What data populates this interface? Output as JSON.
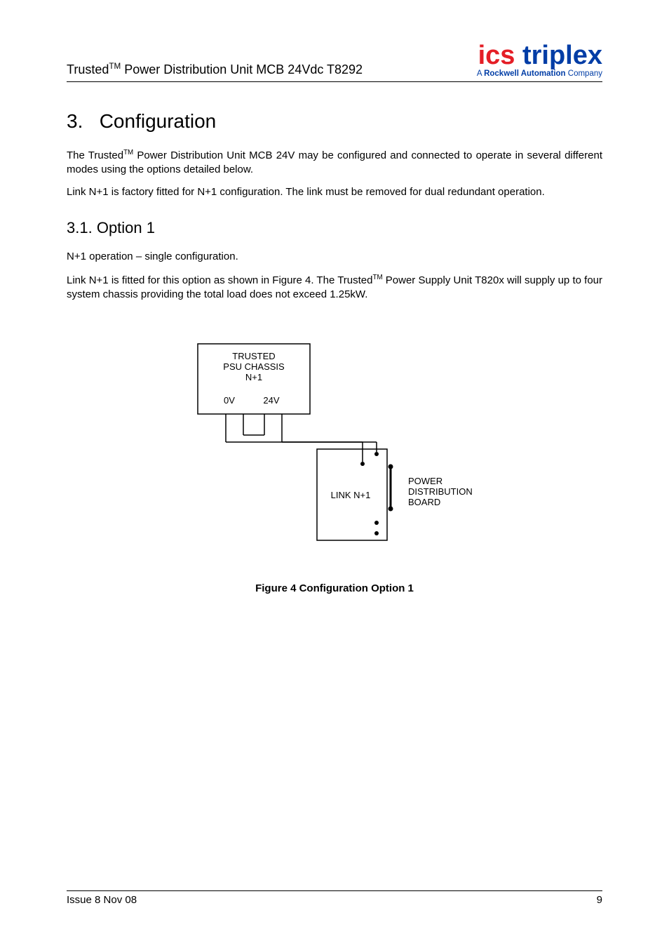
{
  "header": {
    "doc_title_prefix": "Trusted",
    "doc_title_tm": "TM",
    "doc_title_suffix": "  Power Distribution Unit MCB 24Vdc T8292"
  },
  "logo": {
    "ics": "ics",
    "triplex": " triplex",
    "sub_prefix": "A ",
    "sub_bold": "Rockwell Automation",
    "sub_suffix": " Company"
  },
  "section": {
    "number": "3.",
    "title": "Configuration"
  },
  "para1_prefix": "The Trusted",
  "para1_tm": "TM",
  "para1_suffix": " Power Distribution Unit MCB 24V may be configured and connected to operate in several different modes using the options detailed below.",
  "para2": "Link N+1 is factory fitted for N+1 configuration.  The link must be removed for dual redundant operation.",
  "subsection": {
    "number": "3.1.",
    "title": "Option 1"
  },
  "para3": "N+1 operation – single configuration.",
  "para4_prefix": "Link N+1 is fitted for this option as shown in Figure 4.  The Trusted",
  "para4_tm": "TM",
  "para4_suffix": " Power Supply Unit T820x will supply up to four system chassis providing the total load does not exceed 1.25kW.",
  "diagram": {
    "psu_line1": "TRUSTED",
    "psu_line2": "PSU CHASSIS",
    "psu_line3": "N+1",
    "label_0v": "0V",
    "label_24v": "24V",
    "link_label": "LINK N+1",
    "board_line1": "POWER",
    "board_line2": "DISTRIBUTION",
    "board_line3": "BOARD"
  },
  "figure_caption": "Figure 4 Configuration Option 1",
  "footer": {
    "left": "Issue 8 Nov 08",
    "right": "9"
  }
}
